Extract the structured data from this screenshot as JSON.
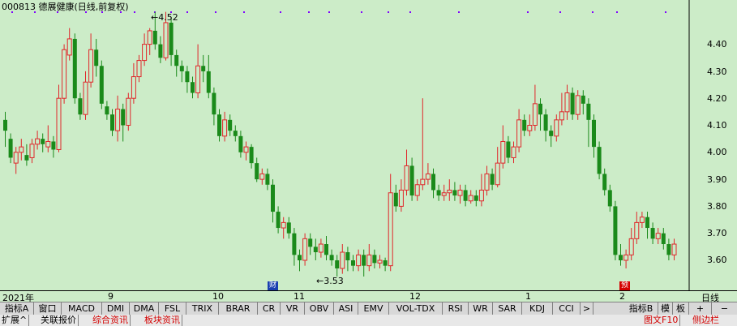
{
  "chart_title": "000813 德展健康(日线,前复权)",
  "y_labels": [
    "4.40",
    "4.30",
    "4.20",
    "4.10",
    "4.00",
    "3.90",
    "3.80",
    "3.70",
    "3.60"
  ],
  "x_labels": [
    "2021年",
    "9",
    "10",
    "11",
    "12",
    "1",
    "2"
  ],
  "period_label": "日线",
  "high_marker": "4.52",
  "low_marker": "3.53",
  "event_marker_1": "财",
  "event_marker_2": "预",
  "indicator_tabs": [
    "指标A",
    "窗口",
    "MACD",
    "DMI",
    "DMA",
    "FSL",
    "TRIX",
    "BRAR",
    "CR",
    "VR",
    "OBV",
    "ASI",
    "EMV",
    "VOL-TDX",
    "RSI",
    "WR",
    "SAR",
    "KDJ",
    "CCI",
    ">"
  ],
  "right_tabs": [
    "指标B",
    "模",
    "板",
    "+",
    "−"
  ],
  "bottom_tabs": [
    "扩展^",
    "关联报价",
    "综合资讯",
    "板块资讯"
  ],
  "right_status": "图文F10",
  "right_status_extra": "侧边栏",
  "colors": {
    "up": "#e0262a",
    "down": "#1a8a1a",
    "background": "#ccecc8",
    "marker_dots": "#8000ff"
  },
  "chart_data": {
    "type": "candlestick",
    "ylim": [
      3.53,
      4.52
    ],
    "candles": [
      [
        4.12,
        4.08,
        4.15,
        4.02
      ],
      [
        4.05,
        3.98,
        4.07,
        3.96
      ],
      [
        3.96,
        4.0,
        4.02,
        3.92
      ],
      [
        4.0,
        4.02,
        4.05,
        3.97
      ],
      [
        3.99,
        3.97,
        4.03,
        3.95
      ],
      [
        3.98,
        4.03,
        4.05,
        3.96
      ],
      [
        4.03,
        4.05,
        4.08,
        4.01
      ],
      [
        4.05,
        4.03,
        4.07,
        4.0
      ],
      [
        4.02,
        4.04,
        4.1,
        4.0
      ],
      [
        4.04,
        4.01,
        4.06,
        3.98
      ],
      [
        4.01,
        4.2,
        4.25,
        4.0
      ],
      [
        4.2,
        4.38,
        4.4,
        4.18
      ],
      [
        4.36,
        4.42,
        4.46,
        4.34
      ],
      [
        4.42,
        4.2,
        4.44,
        4.18
      ],
      [
        4.2,
        4.14,
        4.22,
        4.12
      ],
      [
        4.14,
        4.26,
        4.3,
        4.12
      ],
      [
        4.26,
        4.38,
        4.44,
        4.24
      ],
      [
        4.38,
        4.32,
        4.42,
        4.28
      ],
      [
        4.32,
        4.18,
        4.34,
        4.16
      ],
      [
        4.17,
        4.14,
        4.19,
        4.12
      ],
      [
        4.14,
        4.08,
        4.16,
        4.06
      ],
      [
        4.08,
        4.16,
        4.21,
        4.04
      ],
      [
        4.16,
        4.1,
        4.18,
        4.04
      ],
      [
        4.1,
        4.2,
        4.22,
        4.08
      ],
      [
        4.2,
        4.28,
        4.33,
        4.18
      ],
      [
        4.28,
        4.34,
        4.36,
        4.26
      ],
      [
        4.34,
        4.4,
        4.44,
        4.32
      ],
      [
        4.4,
        4.45,
        4.46,
        4.36
      ],
      [
        4.45,
        4.4,
        4.52,
        4.38
      ],
      [
        4.4,
        4.35,
        4.43,
        4.33
      ],
      [
        4.35,
        4.48,
        4.52,
        4.34
      ],
      [
        4.48,
        4.36,
        4.5,
        4.32
      ],
      [
        4.36,
        4.32,
        4.38,
        4.28
      ],
      [
        4.32,
        4.3,
        4.34,
        4.26
      ],
      [
        4.3,
        4.26,
        4.32,
        4.22
      ],
      [
        4.26,
        4.22,
        4.28,
        4.2
      ],
      [
        4.22,
        4.32,
        4.4,
        4.2
      ],
      [
        4.32,
        4.3,
        4.36,
        4.26
      ],
      [
        4.3,
        4.22,
        4.36,
        4.2
      ],
      [
        4.22,
        4.14,
        4.24,
        4.1
      ],
      [
        4.14,
        4.06,
        4.16,
        4.04
      ],
      [
        4.06,
        4.12,
        4.15,
        4.04
      ],
      [
        4.12,
        4.08,
        4.14,
        4.06
      ],
      [
        4.08,
        4.06,
        4.1,
        4.04
      ],
      [
        4.06,
        4.0,
        4.08,
        3.98
      ],
      [
        4.0,
        4.02,
        4.04,
        3.97
      ],
      [
        4.02,
        3.96,
        4.03,
        3.94
      ],
      [
        3.96,
        3.9,
        3.98,
        3.89
      ],
      [
        3.9,
        3.92,
        3.94,
        3.88
      ],
      [
        3.92,
        3.88,
        3.94,
        3.86
      ],
      [
        3.88,
        3.78,
        3.9,
        3.74
      ],
      [
        3.78,
        3.72,
        3.8,
        3.7
      ],
      [
        3.72,
        3.74,
        3.76,
        3.68
      ],
      [
        3.74,
        3.7,
        3.76,
        3.68
      ],
      [
        3.7,
        3.62,
        3.72,
        3.58
      ],
      [
        3.62,
        3.6,
        3.64,
        3.56
      ],
      [
        3.6,
        3.68,
        3.7,
        3.58
      ],
      [
        3.68,
        3.65,
        3.7,
        3.62
      ],
      [
        3.65,
        3.63,
        3.68,
        3.6
      ],
      [
        3.63,
        3.66,
        3.68,
        3.61
      ],
      [
        3.66,
        3.62,
        3.69,
        3.6
      ],
      [
        3.62,
        3.6,
        3.64,
        3.58
      ],
      [
        3.6,
        3.57,
        3.62,
        3.54
      ],
      [
        3.57,
        3.63,
        3.66,
        3.55
      ],
      [
        3.63,
        3.6,
        3.65,
        3.56
      ],
      [
        3.6,
        3.58,
        3.62,
        3.56
      ],
      [
        3.58,
        3.62,
        3.64,
        3.56
      ],
      [
        3.62,
        3.58,
        3.64,
        3.54
      ],
      [
        3.58,
        3.62,
        3.66,
        3.56
      ],
      [
        3.62,
        3.59,
        3.64,
        3.57
      ],
      [
        3.59,
        3.6,
        3.62,
        3.57
      ],
      [
        3.6,
        3.58,
        3.61,
        3.56
      ],
      [
        3.58,
        3.85,
        3.92,
        3.56
      ],
      [
        3.85,
        3.8,
        3.88,
        3.78
      ],
      [
        3.8,
        3.86,
        3.9,
        3.78
      ],
      [
        3.86,
        3.95,
        4.01,
        3.84
      ],
      [
        3.95,
        3.84,
        3.98,
        3.82
      ],
      [
        3.84,
        3.88,
        3.9,
        3.82
      ],
      [
        3.88,
        3.9,
        4.2,
        3.86
      ],
      [
        3.9,
        3.92,
        3.96,
        3.88
      ],
      [
        3.92,
        3.86,
        3.94,
        3.83
      ],
      [
        3.86,
        3.84,
        3.88,
        3.82
      ],
      [
        3.84,
        3.85,
        3.88,
        3.82
      ],
      [
        3.85,
        3.86,
        3.9,
        3.82
      ],
      [
        3.86,
        3.84,
        3.89,
        3.82
      ],
      [
        3.84,
        3.86,
        3.88,
        3.81
      ],
      [
        3.86,
        3.82,
        3.88,
        3.8
      ],
      [
        3.82,
        3.84,
        3.86,
        3.81
      ],
      [
        3.84,
        3.82,
        3.86,
        3.8
      ],
      [
        3.82,
        3.86,
        3.92,
        3.8
      ],
      [
        3.86,
        3.92,
        3.95,
        3.84
      ],
      [
        3.92,
        3.88,
        3.94,
        3.86
      ],
      [
        3.88,
        3.96,
        4.02,
        3.87
      ],
      [
        3.96,
        4.04,
        4.1,
        3.94
      ],
      [
        4.04,
        3.98,
        4.06,
        3.96
      ],
      [
        3.98,
        4.02,
        4.04,
        3.96
      ],
      [
        4.02,
        4.12,
        4.16,
        4.0
      ],
      [
        4.12,
        4.08,
        4.14,
        4.06
      ],
      [
        4.08,
        4.1,
        4.14,
        4.06
      ],
      [
        4.1,
        4.18,
        4.25,
        4.08
      ],
      [
        4.18,
        4.14,
        4.2,
        4.08
      ],
      [
        4.14,
        4.08,
        4.16,
        4.04
      ],
      [
        4.08,
        4.06,
        4.1,
        4.02
      ],
      [
        4.06,
        4.12,
        4.14,
        4.04
      ],
      [
        4.12,
        4.15,
        4.22,
        4.1
      ],
      [
        4.15,
        4.22,
        4.25,
        4.12
      ],
      [
        4.22,
        4.14,
        4.24,
        4.12
      ],
      [
        4.14,
        4.21,
        4.23,
        4.12
      ],
      [
        4.21,
        4.18,
        4.23,
        4.14
      ],
      [
        4.18,
        4.12,
        4.2,
        4.02
      ],
      [
        4.12,
        4.02,
        4.14,
        3.98
      ],
      [
        4.02,
        3.92,
        4.04,
        3.9
      ],
      [
        3.92,
        3.86,
        3.94,
        3.84
      ],
      [
        3.86,
        3.8,
        3.88,
        3.78
      ],
      [
        3.8,
        3.62,
        3.82,
        3.6
      ],
      [
        3.62,
        3.6,
        3.66,
        3.58
      ],
      [
        3.6,
        3.62,
        3.64,
        3.57
      ],
      [
        3.62,
        3.68,
        3.72,
        3.6
      ],
      [
        3.68,
        3.74,
        3.78,
        3.66
      ],
      [
        3.74,
        3.76,
        3.78,
        3.72
      ],
      [
        3.76,
        3.72,
        3.78,
        3.68
      ],
      [
        3.72,
        3.68,
        3.74,
        3.66
      ],
      [
        3.68,
        3.7,
        3.72,
        3.66
      ],
      [
        3.7,
        3.66,
        3.72,
        3.64
      ],
      [
        3.66,
        3.62,
        3.68,
        3.6
      ],
      [
        3.62,
        3.66,
        3.68,
        3.6
      ]
    ]
  }
}
